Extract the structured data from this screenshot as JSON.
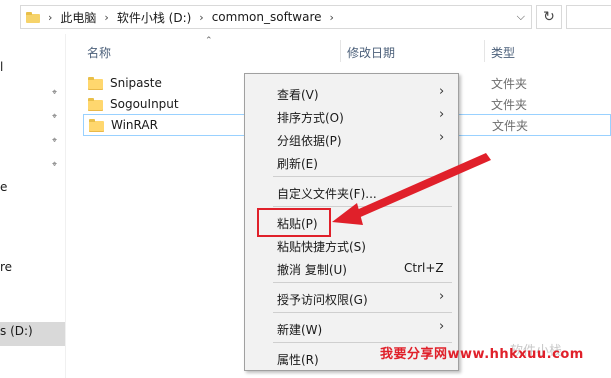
{
  "address_bar": {
    "breadcrumbs": [
      "此电脑",
      "软件小栈 (D:)",
      "common_software"
    ],
    "refresh_icon": "refresh-icon"
  },
  "nav_pane": {
    "fragments": [
      "l",
      "e",
      "re",
      "s (D:)"
    ]
  },
  "columns": {
    "name": "名称",
    "modified": "修改日期",
    "type": "类型"
  },
  "files": [
    {
      "name": "Snipaste",
      "type": "文件夹"
    },
    {
      "name": "SogouInput",
      "type": "文件夹"
    },
    {
      "name": "WinRAR",
      "type": "文件夹"
    }
  ],
  "context_menu": {
    "items": [
      {
        "label": "查看(V)",
        "accel": "",
        "submenu": true
      },
      {
        "label": "排序方式(O)",
        "accel": "",
        "submenu": true
      },
      {
        "label": "分组依据(P)",
        "accel": "",
        "submenu": true
      },
      {
        "label": "刷新(E)",
        "accel": "",
        "submenu": false
      },
      {
        "label": "自定义文件夹(F)...",
        "accel": "",
        "submenu": false
      },
      {
        "label": "粘贴(P)",
        "accel": "",
        "submenu": false
      },
      {
        "label": "粘贴快捷方式(S)",
        "accel": "",
        "submenu": false
      },
      {
        "label": "撤消 复制(U)",
        "accel": "Ctrl+Z",
        "submenu": false
      },
      {
        "label": "授予访问权限(G)",
        "accel": "",
        "submenu": true
      },
      {
        "label": "新建(W)",
        "accel": "",
        "submenu": true
      },
      {
        "label": "属性(R)",
        "accel": "",
        "submenu": false
      }
    ]
  },
  "annotation": {
    "color": "#e0202a"
  },
  "watermark": {
    "text": "我要分享网www.hhkxuu.com",
    "faint_text": "软件小栈"
  }
}
